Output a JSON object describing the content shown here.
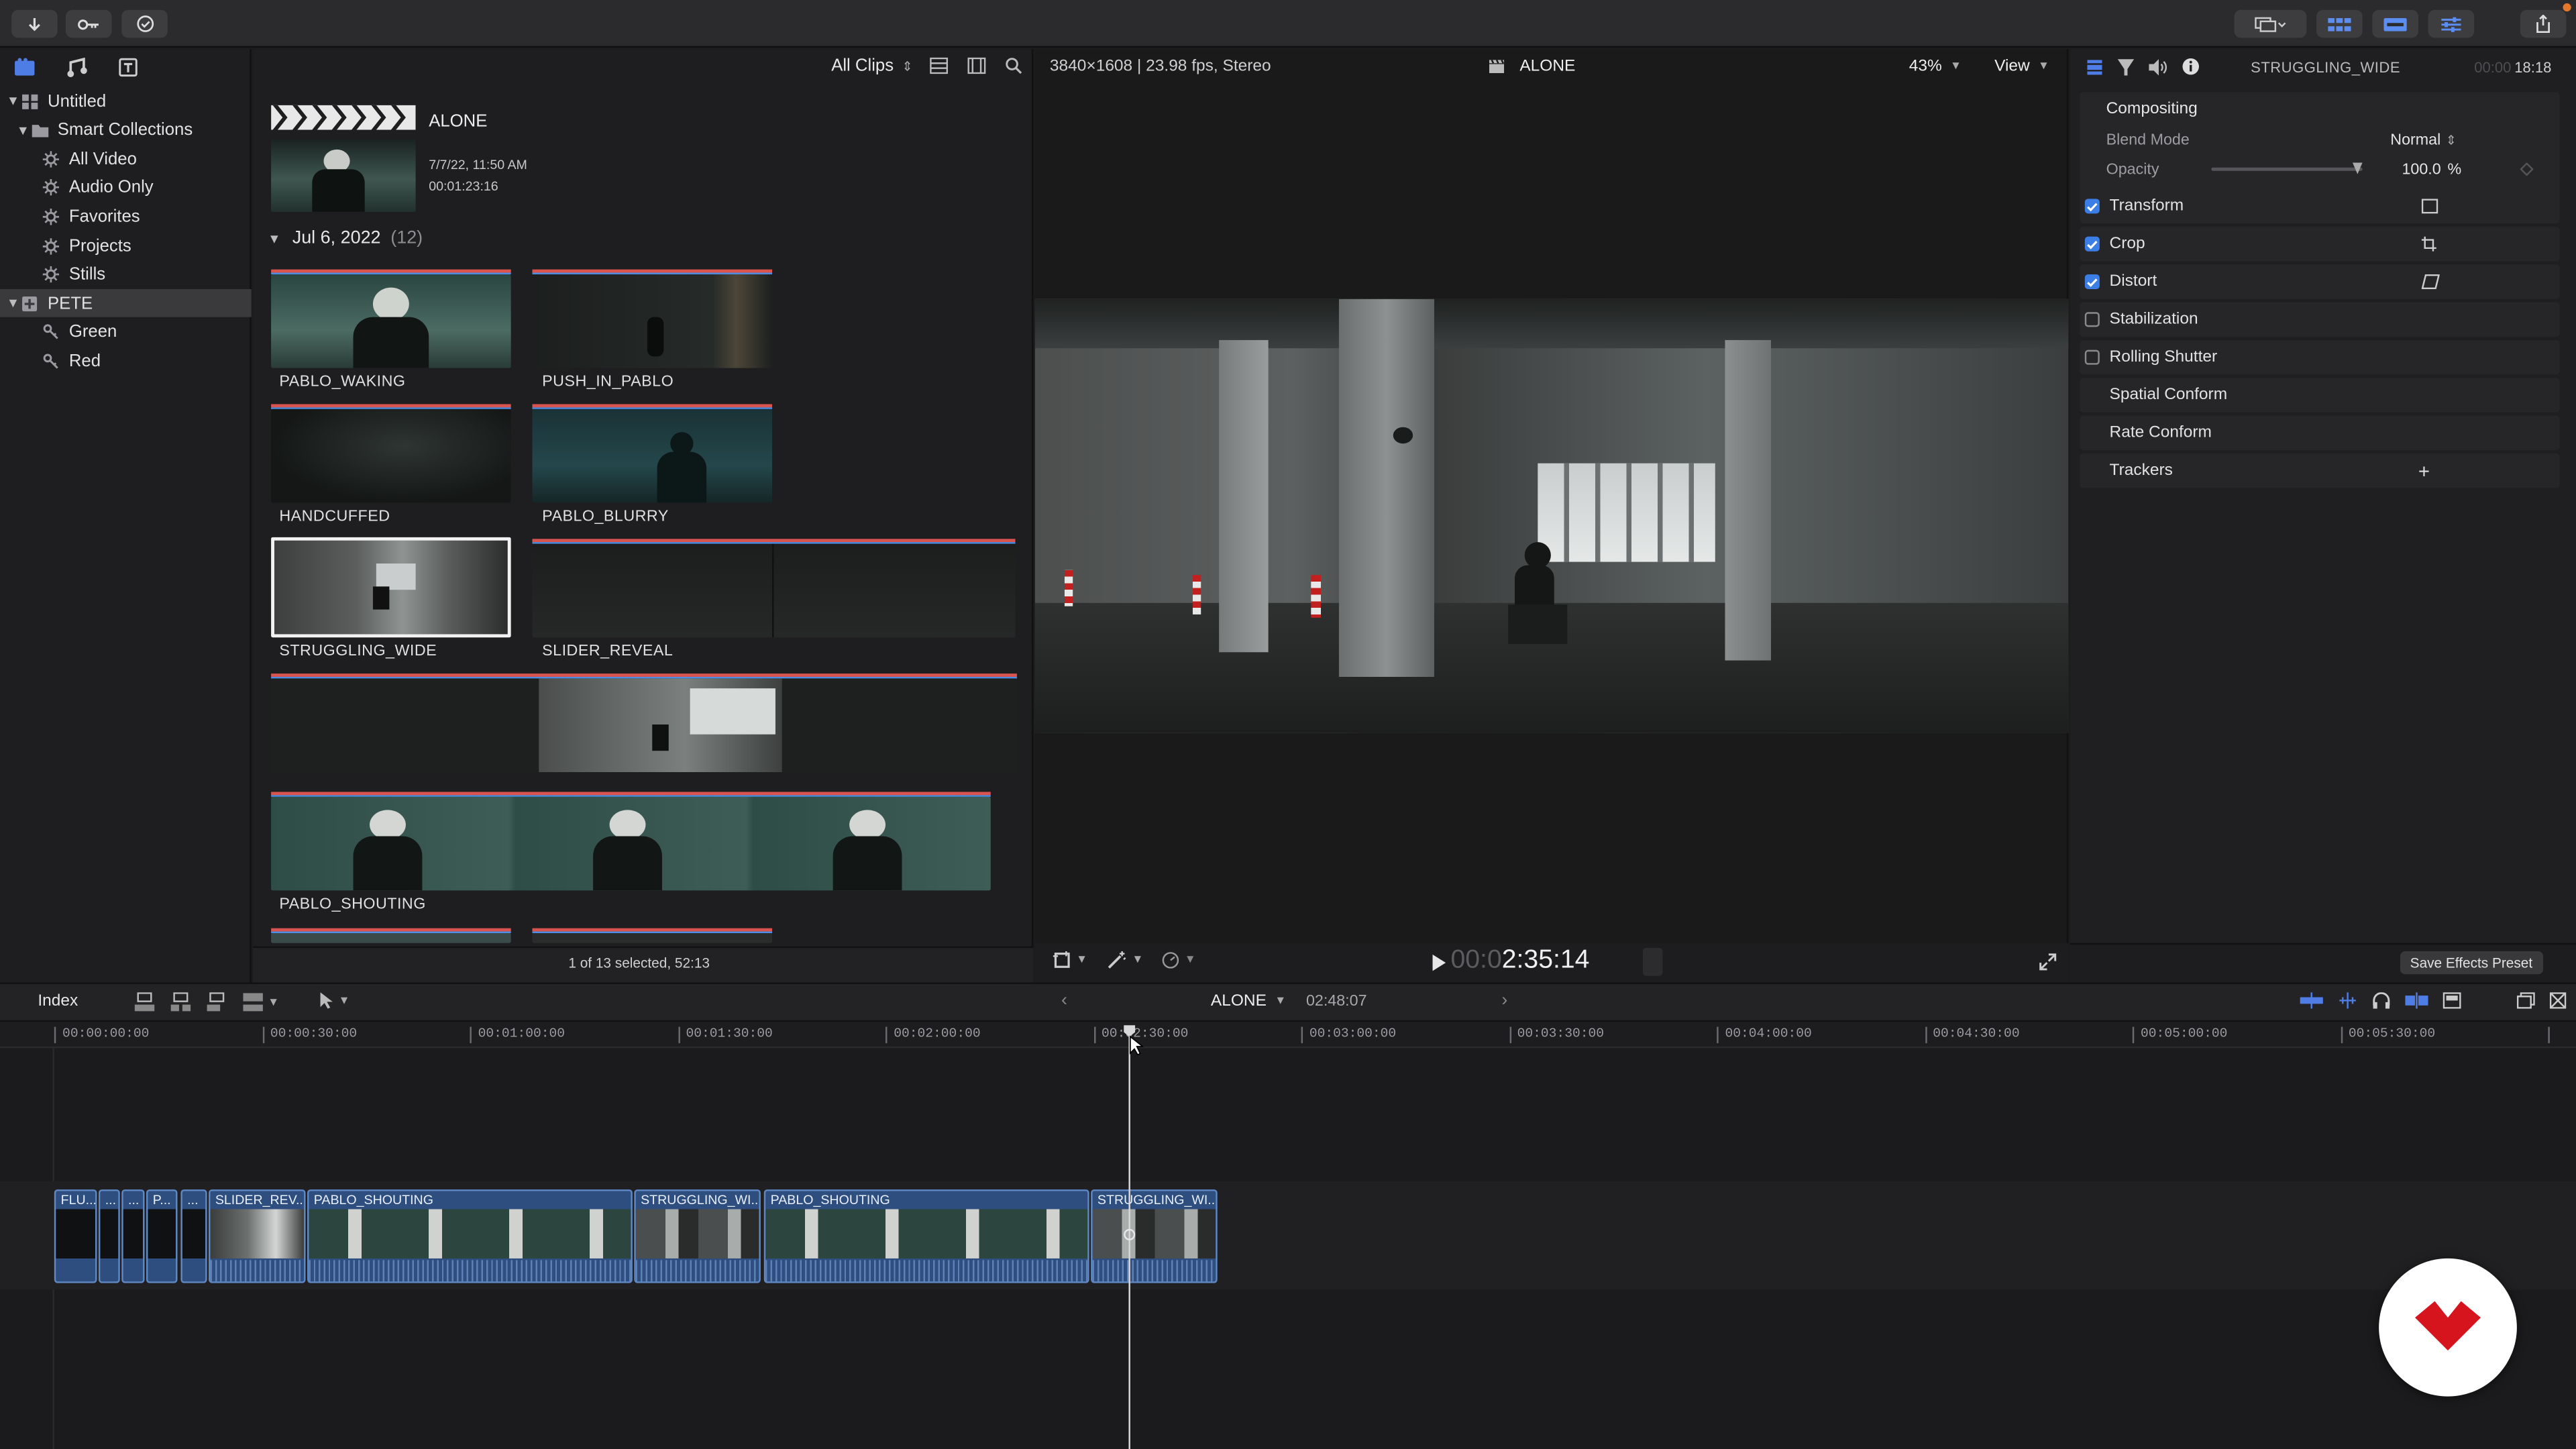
{
  "toolbar": {
    "import_icon": "download-arrow-icon",
    "keywords_icon": "key-icon",
    "background_tasks_icon": "checkmark-circle-icon"
  },
  "library": {
    "items": [
      {
        "label": "Untitled",
        "icon": "library-grid-icon",
        "level": 0,
        "expanded": true
      },
      {
        "label": "Smart Collections",
        "icon": "folder-icon",
        "level": 1,
        "expanded": true
      },
      {
        "label": "All Video",
        "icon": "gear-icon",
        "level": 2
      },
      {
        "label": "Audio Only",
        "icon": "gear-icon",
        "level": 2
      },
      {
        "label": "Favorites",
        "icon": "gear-icon",
        "level": 2
      },
      {
        "label": "Projects",
        "icon": "gear-icon",
        "level": 2
      },
      {
        "label": "Stills",
        "icon": "gear-icon",
        "level": 2
      },
      {
        "label": "PETE",
        "icon": "event-star-icon",
        "level": 0,
        "expanded": true,
        "selected": true
      },
      {
        "label": "Green",
        "icon": "keyword-icon",
        "level": 2
      },
      {
        "label": "Red",
        "icon": "keyword-icon",
        "level": 2
      }
    ]
  },
  "browser": {
    "filter": "All Clips",
    "project": {
      "name": "ALONE",
      "date": "7/7/22, 11:50 AM",
      "duration": "00:01:23:16"
    },
    "group": {
      "label": "Jul 6, 2022",
      "count": "(12)"
    },
    "clips": [
      {
        "name": "PABLO_WAKING"
      },
      {
        "name": "PUSH_IN_PABLO"
      },
      {
        "name": "HANDCUFFED"
      },
      {
        "name": "PABLO_BLURRY"
      },
      {
        "name": "STRUGGLING_WIDE"
      },
      {
        "name": "SLIDER_REVEAL"
      },
      {
        "name": "PABLO_SHOUTING"
      }
    ],
    "status": "1 of 13 selected, 52:13"
  },
  "viewer": {
    "format": "3840×1608 | 23.98 fps, Stereo",
    "title": "ALONE",
    "zoom": "43%",
    "view_label": "View",
    "timecode_dim": "00:0",
    "timecode": "2:35:14"
  },
  "inspector": {
    "clip": "STRUGGLING_WIDE",
    "duration_dim": "00:00",
    "duration": "18:18",
    "compositing": "Compositing",
    "blend_mode_label": "Blend Mode",
    "blend_mode_value": "Normal",
    "opacity_label": "Opacity",
    "opacity_value": "100.0",
    "opacity_unit": "%",
    "sections": [
      {
        "label": "Transform",
        "checked": true,
        "icon": "transform-icon"
      },
      {
        "label": "Crop",
        "checked": true,
        "icon": "crop-icon"
      },
      {
        "label": "Distort",
        "checked": true,
        "icon": "distort-icon"
      },
      {
        "label": "Stabilization",
        "checked": false
      },
      {
        "label": "Rolling Shutter",
        "checked": false
      },
      {
        "label": "Spatial Conform"
      },
      {
        "label": "Rate Conform"
      },
      {
        "label": "Trackers",
        "add": "+"
      }
    ],
    "save_preset": "Save Effects Preset"
  },
  "timeline": {
    "index_label": "Index",
    "project": "ALONE",
    "duration": "02:48:07",
    "ruler": [
      "00:00:00:00",
      "00:00:30:00",
      "00:01:00:00",
      "00:01:30:00",
      "00:02:00:00",
      "00:02:30:00",
      "00:03:00:00",
      "00:03:30:00",
      "00:04:00:00",
      "00:04:30:00",
      "00:05:00:00",
      "00:05:30:00"
    ],
    "clips": [
      {
        "label": "FLU..."
      },
      {
        "label": "..."
      },
      {
        "label": "..."
      },
      {
        "label": "P..."
      },
      {
        "label": "..."
      },
      {
        "label": "SLIDER_REV..."
      },
      {
        "label": "PABLO_SHOUTING"
      },
      {
        "label": "STRUGGLING_WI..."
      },
      {
        "label": "PABLO_SHOUTING"
      },
      {
        "label": "STRUGGLING_WI..."
      }
    ]
  },
  "colors": {
    "accent": "#3b7ee6",
    "clip_blue": "#2d4e7e",
    "badge_red": "#d6141e"
  }
}
